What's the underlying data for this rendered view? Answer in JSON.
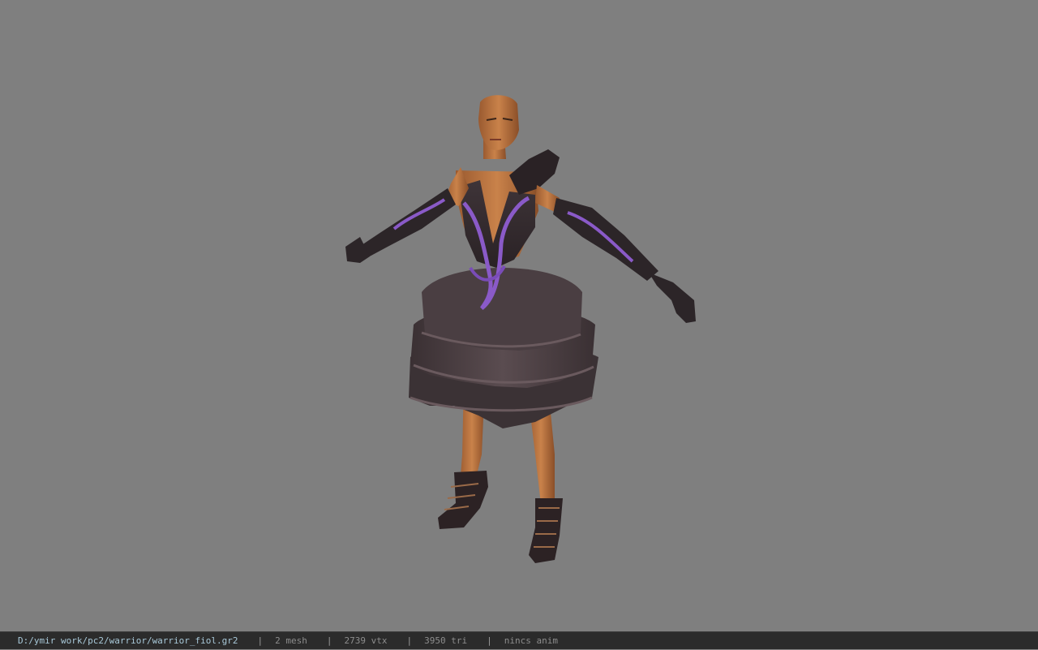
{
  "viewer": {
    "background_color": "#7f7f7f",
    "model_name": "warrior_fiol"
  },
  "status_bar": {
    "file_path": "D:/ymir work/pc2/warrior/warrior_fiol.gr2",
    "separator": "|",
    "mesh_count": "2 mesh",
    "vertex_count": "2739 vtx",
    "triangle_count": "3950 tri",
    "animation": "nincs anim"
  }
}
